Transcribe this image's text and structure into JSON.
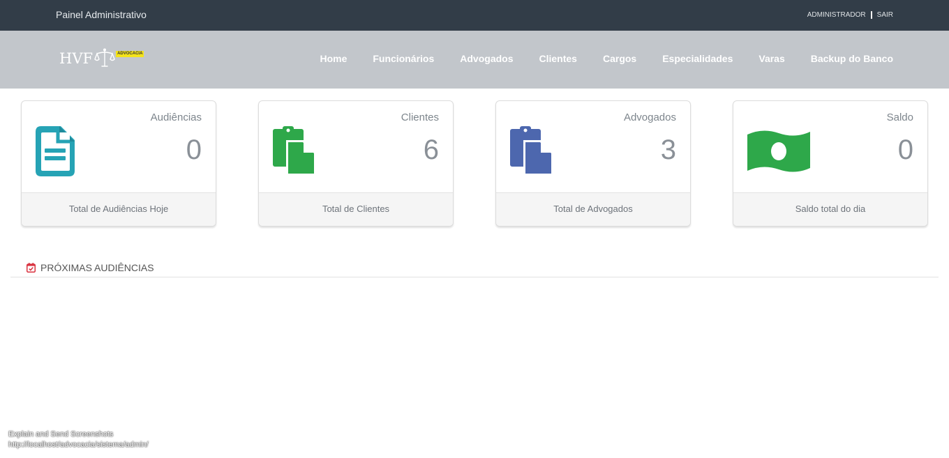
{
  "topbar": {
    "title": "Painel Administrativo",
    "user_label": "ADMINISTRADOR",
    "logout_label": "SAIR"
  },
  "logo": {
    "letters": "HVF",
    "badge": "ADVOCACIA"
  },
  "nav": {
    "items": [
      "Home",
      "Funcionários",
      "Advogados",
      "Clientes",
      "Cargos",
      "Especialidades",
      "Varas",
      "Backup do Banco"
    ]
  },
  "cards": [
    {
      "label": "Audiências",
      "value": "0",
      "footer": "Total de Audiências Hoje",
      "icon": "document-icon",
      "color": "#26a3b5"
    },
    {
      "label": "Clientes",
      "value": "6",
      "footer": "Total de Clientes",
      "icon": "copy-icon",
      "color": "#2ea84a"
    },
    {
      "label": "Advogados",
      "value": "3",
      "footer": "Total de Advogados",
      "icon": "copy-icon",
      "color": "#4d67ae"
    },
    {
      "label": "Saldo",
      "value": "0",
      "footer": "Saldo total do dia",
      "icon": "money-icon",
      "color": "#2ea84a"
    }
  ],
  "section": {
    "title": "PRÓXIMAS AUDIÊNCIAS",
    "icon": "calendar-check-icon",
    "icon_color": "#d9303e"
  },
  "overlay": {
    "line1": "Explain and Send Screenshots",
    "line2": "http://localhost/advocacia/sistema/admin/"
  }
}
